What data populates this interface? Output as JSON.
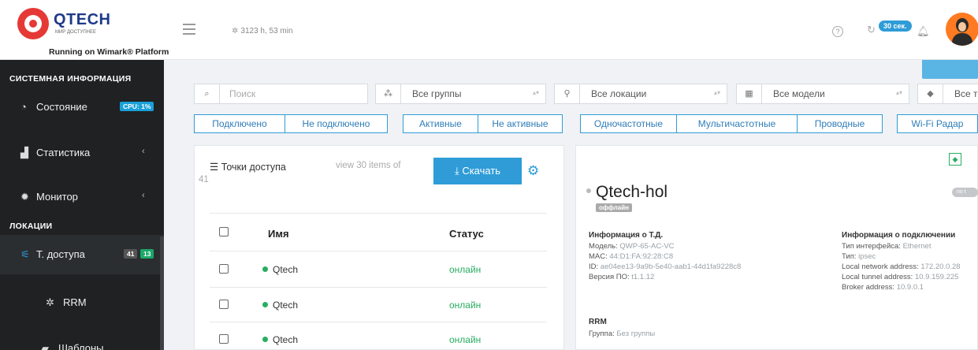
{
  "header": {
    "logo_name": "QTECH",
    "logo_sub": "МИР ДОСТУПНЕЕ",
    "platform": "Running on Wimark® Platform",
    "uptime": "3123 h, 53 min",
    "timer": "30 сек.",
    "help": "?"
  },
  "sidebar": {
    "sections": [
      "СИСТЕМНАЯ ИНФОРМАЦИЯ",
      "ЛОКАЦИИ"
    ],
    "items": [
      {
        "label": "Состояние",
        "badge": "CPU: 1%"
      },
      {
        "label": "Статистика"
      },
      {
        "label": "Монитор"
      },
      {
        "label": "Т. доступа",
        "badge1": "41",
        "badge2": "13"
      },
      {
        "label": "RRM"
      },
      {
        "label": "Шаблоны"
      }
    ]
  },
  "filters": {
    "search_placeholder": "Поиск",
    "groups": "Все группы",
    "locations": "Все локации",
    "models": "Все модели",
    "tags": "Все т"
  },
  "chips": [
    "Подключено",
    "Не подключено",
    "Активные",
    "Не активные",
    "Одночастотные",
    "Мультичастотные",
    "Проводные",
    "Wi-Fi Радар"
  ],
  "list": {
    "title": "Точки доступа",
    "view": "view 30 items of",
    "total": "41",
    "download": "Скачать",
    "columns": {
      "name": "Имя",
      "status": "Статус"
    },
    "rows": [
      {
        "name": "Qtech",
        "status": "онлайн"
      },
      {
        "name": "Qtech",
        "status": "онлайн"
      },
      {
        "name": "Qtech",
        "status": "онлайн"
      }
    ]
  },
  "detail": {
    "name": "Qtech-hol",
    "state": "оффлайн",
    "tag_pill": "no t",
    "info": {
      "title": "Информация о Т.Д.",
      "model_key": "Модель:",
      "model": "QWP-65-AC-VC",
      "mac_key": "MAC:",
      "mac": "44:D1:FA:92:28:C8",
      "id_key": "ID:",
      "id": "ae04ee13-9a9b-5e40-aab1-44d1fa9228c8",
      "fw_key": "Версия ПО:",
      "fw": "t1.1.12"
    },
    "conn": {
      "title": "Информация о подключении",
      "iface_key": "Тип интерфейса:",
      "iface": "Ethernet",
      "type_key": "Тип:",
      "type": "ipsec",
      "lna_key": "Local network address:",
      "lna": "172.20.0.28",
      "lta_key": "Local tunnel address:",
      "lta": "10.9.159.225",
      "broker_key": "Broker address:",
      "broker": "10.9.0.1"
    },
    "rrm": {
      "title": "RRM",
      "group_key": "Группа:",
      "group": "Без группы"
    }
  },
  "colors": {
    "accent": "#2f9cd7",
    "sidebar": "#1f2123",
    "online": "#27ae60",
    "brand": "#e53935"
  }
}
